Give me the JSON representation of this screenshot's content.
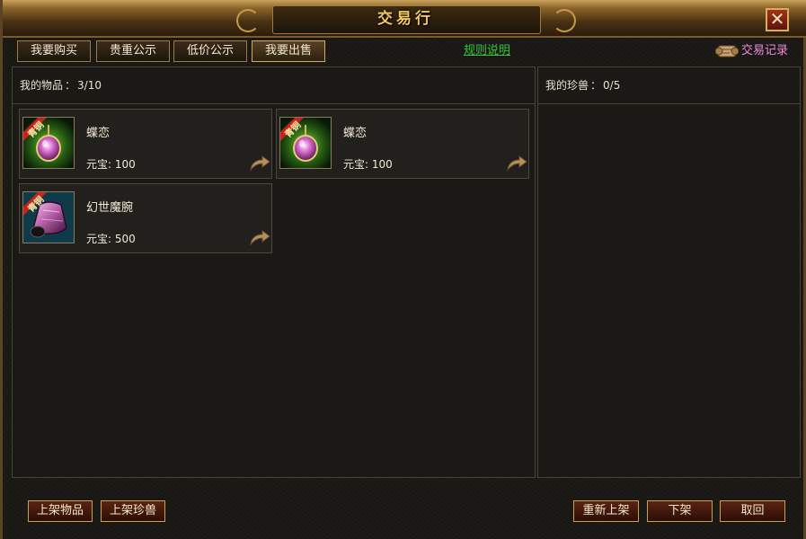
{
  "window": {
    "title": "交易行",
    "close_label": "✕"
  },
  "tabs": [
    {
      "label": "我要购买"
    },
    {
      "label": "贵重公示"
    },
    {
      "label": "低价公示"
    },
    {
      "label": "我要出售"
    }
  ],
  "rules_link": "规则说明",
  "trade_record": "交易记录",
  "items_panel": {
    "label": "我的物品",
    "sep": "：",
    "count": "3/10"
  },
  "pets_panel": {
    "label": "我的珍兽",
    "sep": "：",
    "count": "0/5"
  },
  "items": [
    {
      "name": "蝶恋",
      "price_label": "元宝:",
      "price": "100",
      "tag": "青铜",
      "icon": "pink-gem-pendant-icon"
    },
    {
      "name": "蝶恋",
      "price_label": "元宝:",
      "price": "100",
      "tag": "青铜",
      "icon": "pink-gem-pendant-icon"
    },
    {
      "name": "幻世魔腕",
      "price_label": "元宝:",
      "price": "500",
      "tag": "青铜",
      "icon": "bracer-icon"
    }
  ],
  "buttons": {
    "list_item": "上架物品",
    "list_pet": "上架珍兽",
    "relist": "重新上架",
    "delist": "下架",
    "retrieve": "取回"
  },
  "colors": {
    "title_gold": "#f1c85b",
    "link_green": "#37c43a",
    "record_pink": "#ef8ad9"
  }
}
